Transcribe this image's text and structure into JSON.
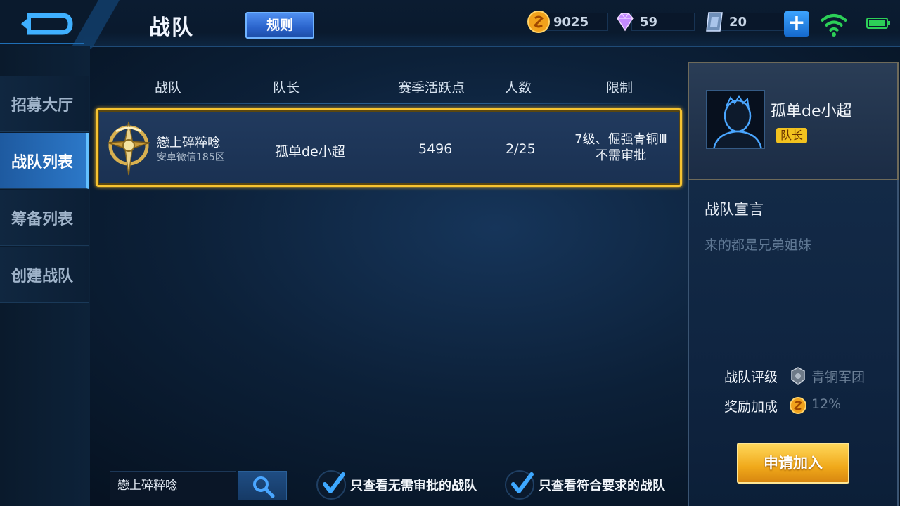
{
  "header": {
    "title": "战队",
    "rules_label": "规则",
    "currencies": [
      {
        "icon": "gold-coin-icon",
        "value": "9025"
      },
      {
        "icon": "diamond-icon",
        "value": "59"
      },
      {
        "icon": "voucher-icon",
        "value": "20"
      }
    ],
    "plus_label": "+"
  },
  "sidebar": {
    "items": [
      {
        "label": "招募大厅"
      },
      {
        "label": "战队列表"
      },
      {
        "label": "筹备列表"
      },
      {
        "label": "创建战队"
      }
    ],
    "active_index": 1
  },
  "table": {
    "columns": [
      "战队",
      "队长",
      "赛季活跃点",
      "人数",
      "限制"
    ],
    "rows": [
      {
        "team_name": "戀上碎粹唸",
        "server": "安卓微信185区",
        "captain": "孤单de小超",
        "activity": "5496",
        "members": "2/25",
        "limit_line1": "7级、倔强青铜Ⅲ",
        "limit_line2": "不需审批"
      }
    ]
  },
  "search": {
    "value": "戀上碎粹唸"
  },
  "filters": [
    {
      "label": "只查看无需审批的战队",
      "checked": true
    },
    {
      "label": "只查看符合要求的战队",
      "checked": true
    }
  ],
  "detail": {
    "captain_name": "孤单de小超",
    "captain_badge": "队长",
    "declaration_title": "战队宣言",
    "declaration_text": "来的都是兄弟姐妹",
    "rating_label": "战队评级",
    "rating_value": "青铜军团",
    "bonus_label": "奖励加成",
    "bonus_value": "12%",
    "apply_label": "申请加入"
  },
  "colors": {
    "accent_blue": "#2c78c8",
    "highlight_gold": "#f7c431",
    "apply_gold": "#f0a91a"
  }
}
